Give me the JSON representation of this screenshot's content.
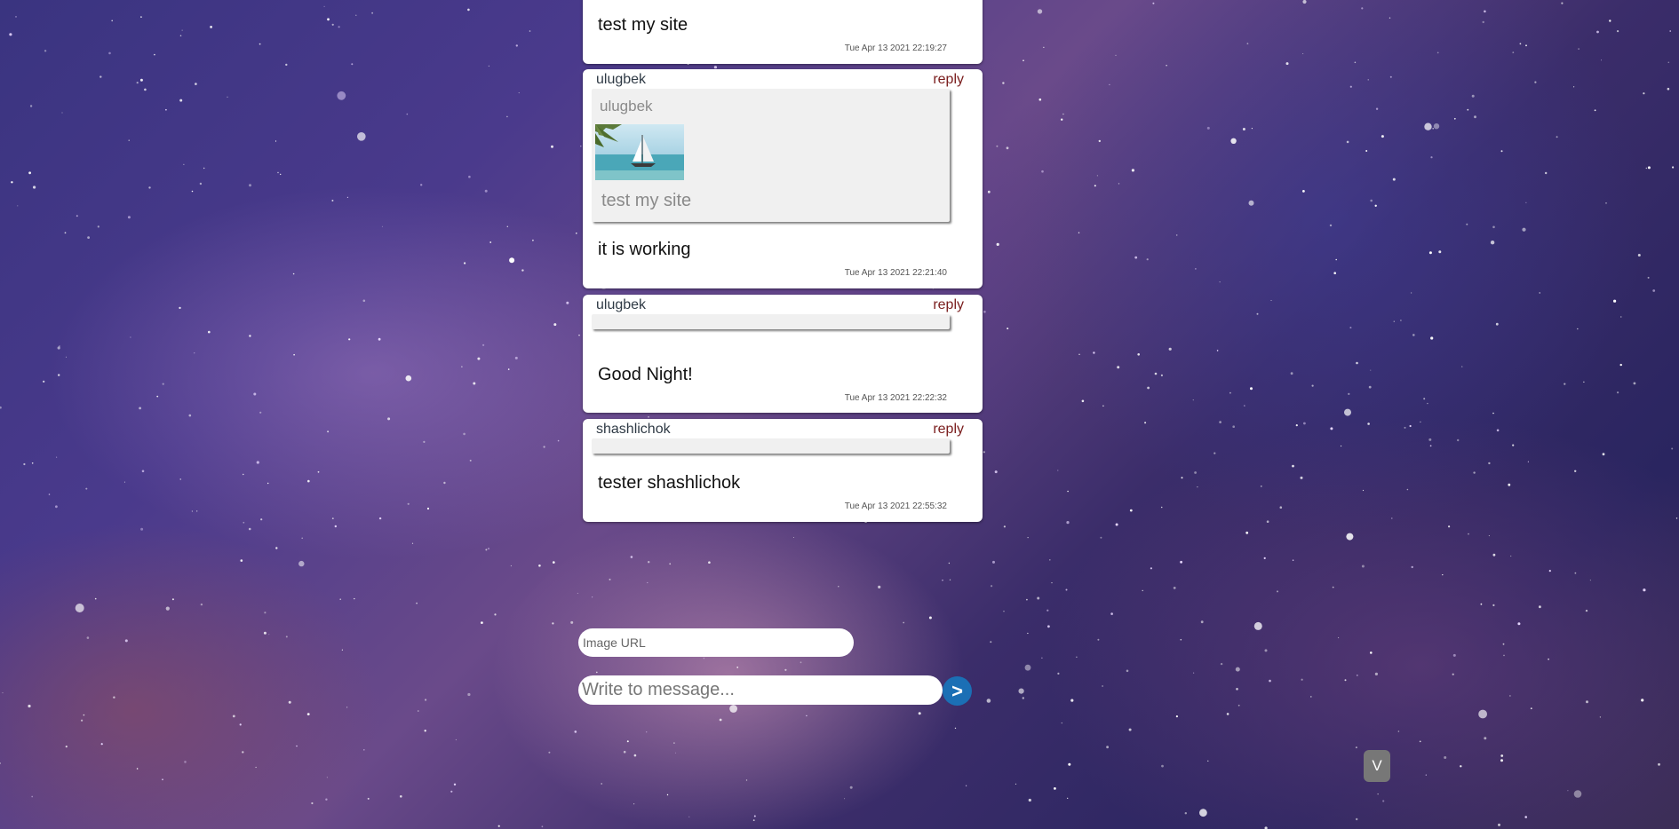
{
  "messages": [
    {
      "text": "test my site",
      "time": "Tue Apr 13 2021 22:19:27"
    },
    {
      "author": "ulugbek",
      "reply_label": "reply",
      "quote": {
        "author": "ulugbek",
        "image_icon": "sailboat-beach-thumbnail",
        "text": "test my site"
      },
      "text": "it is working",
      "time": "Tue Apr 13 2021 22:21:40"
    },
    {
      "author": "ulugbek",
      "reply_label": "reply",
      "text": "Good Night!",
      "time": "Tue Apr 13 2021 22:22:32"
    },
    {
      "author": "shashlichok",
      "reply_label": "reply",
      "text": "tester shashlichok",
      "time": "Tue Apr 13 2021 22:55:32"
    }
  ],
  "composer": {
    "image_url_placeholder": "Image URL",
    "message_placeholder": "Write to message...",
    "send_label": ">"
  },
  "scroll_button_label": "V",
  "colors": {
    "reply_link": "#7a1d1d",
    "send_button": "#1b6fb5",
    "scroll_button": "#777777",
    "quote_background": "#f0f0f0"
  }
}
